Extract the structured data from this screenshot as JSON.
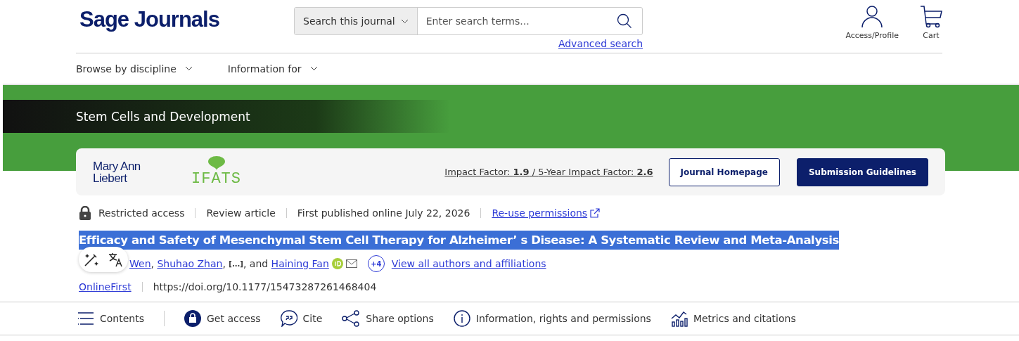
{
  "header": {
    "logo": "Sage Journals",
    "search": {
      "scope": "Search this journal",
      "placeholder": "Enter search terms...",
      "advanced": "Advanced search"
    },
    "account": [
      {
        "kind": "profile",
        "label": "Access/Profile"
      },
      {
        "kind": "cart",
        "label": "Cart"
      }
    ]
  },
  "nav": [
    "Browse by discipline",
    "Information for"
  ],
  "journal": {
    "name": "Stem Cells and Development",
    "publisher": "Mary Ann Liebert",
    "partner": "IFATS",
    "metrics_separator": "/",
    "metrics": [
      {
        "label": "Impact Factor: ",
        "value": "1.9"
      },
      {
        "label": "5-Year Impact Factor: ",
        "value": "2.6"
      }
    ],
    "buttons": [
      {
        "label": "Journal Homepage",
        "kind": "outline"
      },
      {
        "label": "Submission Guidelines",
        "kind": "filled"
      }
    ]
  },
  "article": {
    "meta": [
      "Restricted access",
      "Review article",
      "First published online July 22, 2026"
    ],
    "reuse": "Re-use permissions",
    "title": "Efficacy and Safety of Mesenchymal Stem Cell Therapy for Alzheimer’ s Disease: A Systematic Review and Meta-Analysis",
    "title_selected": true,
    "authors": [
      "Wen",
      "Shuhao Zhan"
    ],
    "separator": ",",
    "ellipsis": "[...]",
    "and": ", and",
    "last_author": "Haining Fan",
    "more": "+4",
    "view_all": "View all authors and affiliations",
    "section": "OnlineFirst",
    "doi": "https://doi.org/10.1177/15473287261468404"
  },
  "toolbar": [
    {
      "kind": "contents",
      "label": "Contents"
    },
    {
      "kind": "access",
      "label": "Get access"
    },
    {
      "kind": "cite",
      "label": "Cite"
    },
    {
      "kind": "share",
      "label": "Share options"
    },
    {
      "kind": "info",
      "label": "Information, rights and permissions"
    },
    {
      "kind": "metrics",
      "label": "Metrics and citations"
    }
  ]
}
